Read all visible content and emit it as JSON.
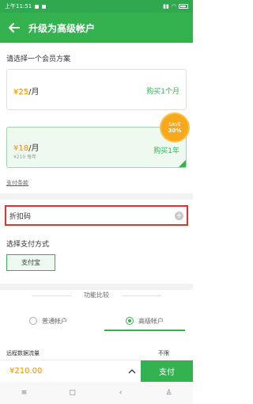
{
  "status": {
    "time": "上午11:51"
  },
  "appbar": {
    "title": "升级为高级帐户",
    "back_icon": "arrow-left-icon"
  },
  "plans": {
    "heading": "请选择一个会员方案",
    "monthly": {
      "price": "¥25",
      "unit": "/月",
      "buy": "购买1个月"
    },
    "yearly": {
      "price": "¥18",
      "unit": "/月",
      "sub": "¥210 每年",
      "buy": "购买1年",
      "badge_line1": "SAVE",
      "badge_line2": "30%"
    }
  },
  "terms_link": "支付条款",
  "discount": {
    "label": "折扣码"
  },
  "payment": {
    "heading": "选择支付方式",
    "method": "支付宝"
  },
  "compare": {
    "title": "功能比较",
    "tabs": [
      {
        "label": "普通帐户"
      },
      {
        "label": "高级帐户"
      }
    ],
    "feature": {
      "name": "远程数据流量",
      "value": "不限"
    }
  },
  "bottom": {
    "total": "¥210.00",
    "pay": "支付"
  },
  "colors": {
    "primary": "#34b24f",
    "price": "#ff8c00",
    "highlight_border": "#e0322c"
  }
}
